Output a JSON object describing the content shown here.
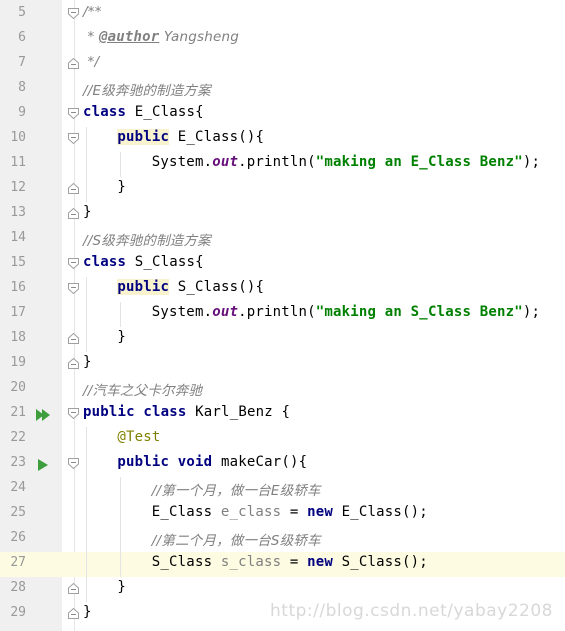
{
  "editor": {
    "language": "Java",
    "current_line": 27,
    "lines": [
      {
        "n": "5",
        "tokens": [
          {
            "t": "/**",
            "c": "comment"
          }
        ],
        "fold": "open"
      },
      {
        "n": "6",
        "tokens": [
          {
            "t": " * ",
            "c": "comment"
          },
          {
            "t": "@author",
            "c": "doctag"
          },
          {
            "t": " Yangsheng",
            "c": "comment"
          }
        ]
      },
      {
        "n": "7",
        "tokens": [
          {
            "t": " */",
            "c": "comment"
          }
        ],
        "fold": "close"
      },
      {
        "n": "8",
        "tokens": [
          {
            "t": "//E级奔驰的制造方案",
            "c": "comment"
          }
        ]
      },
      {
        "n": "9",
        "tokens": [
          {
            "t": "class",
            "c": "kw"
          },
          {
            "t": " E_Class{",
            "c": "plain"
          }
        ],
        "fold": "open"
      },
      {
        "n": "10",
        "indent": 1,
        "tokens": [
          {
            "t": "public",
            "c": "kw-hl"
          },
          {
            "t": " E_Class(){",
            "c": "plain"
          }
        ],
        "fold": "open"
      },
      {
        "n": "11",
        "indent": 2,
        "tokens": [
          {
            "t": "System.",
            "c": "plain"
          },
          {
            "t": "out",
            "c": "field"
          },
          {
            "t": ".println(",
            "c": "plain"
          },
          {
            "t": "\"making an E_Class Benz\"",
            "c": "str"
          },
          {
            "t": ");",
            "c": "plain"
          }
        ]
      },
      {
        "n": "12",
        "indent": 1,
        "tokens": [
          {
            "t": "}",
            "c": "plain"
          }
        ],
        "fold": "close"
      },
      {
        "n": "13",
        "tokens": [
          {
            "t": "}",
            "c": "plain"
          }
        ],
        "fold": "close"
      },
      {
        "n": "14",
        "tokens": [
          {
            "t": "//S级奔驰的制造方案",
            "c": "comment"
          }
        ]
      },
      {
        "n": "15",
        "tokens": [
          {
            "t": "class",
            "c": "kw"
          },
          {
            "t": " S_Class{",
            "c": "plain"
          }
        ],
        "fold": "open"
      },
      {
        "n": "16",
        "indent": 1,
        "tokens": [
          {
            "t": "public",
            "c": "kw-hl"
          },
          {
            "t": " S_Class(){",
            "c": "plain"
          }
        ],
        "fold": "open"
      },
      {
        "n": "17",
        "indent": 2,
        "tokens": [
          {
            "t": "System.",
            "c": "plain"
          },
          {
            "t": "out",
            "c": "field"
          },
          {
            "t": ".println(",
            "c": "plain"
          },
          {
            "t": "\"making an S_Class Benz\"",
            "c": "str"
          },
          {
            "t": ");",
            "c": "plain"
          }
        ]
      },
      {
        "n": "18",
        "indent": 1,
        "tokens": [
          {
            "t": "}",
            "c": "plain"
          }
        ],
        "fold": "close"
      },
      {
        "n": "19",
        "tokens": [
          {
            "t": "}",
            "c": "plain"
          }
        ],
        "fold": "close"
      },
      {
        "n": "20",
        "tokens": [
          {
            "t": "//汽车之父卡尔奔驰",
            "c": "comment"
          }
        ]
      },
      {
        "n": "21",
        "tokens": [
          {
            "t": "public class",
            "c": "kw"
          },
          {
            "t": " Karl_Benz {",
            "c": "plain"
          }
        ],
        "fold": "open",
        "run": "double"
      },
      {
        "n": "22",
        "indent": 1,
        "tokens": [
          {
            "t": "@Test",
            "c": "anno"
          }
        ]
      },
      {
        "n": "23",
        "indent": 1,
        "tokens": [
          {
            "t": "public void",
            "c": "kw"
          },
          {
            "t": " makeCar(){",
            "c": "plain"
          }
        ],
        "fold": "open",
        "run": "single"
      },
      {
        "n": "24",
        "indent": 2,
        "tokens": [
          {
            "t": "//第一个月，做一台E级轿车",
            "c": "comment"
          }
        ]
      },
      {
        "n": "25",
        "indent": 2,
        "tokens": [
          {
            "t": "E_Class ",
            "c": "plain"
          },
          {
            "t": "e_class",
            "c": "var"
          },
          {
            "t": " = ",
            "c": "plain"
          },
          {
            "t": "new",
            "c": "kw"
          },
          {
            "t": " E_Class();",
            "c": "plain"
          }
        ]
      },
      {
        "n": "26",
        "indent": 2,
        "tokens": [
          {
            "t": "//第二个月，做一台S级轿车",
            "c": "comment"
          }
        ]
      },
      {
        "n": "27",
        "indent": 2,
        "tokens": [
          {
            "t": "S_Class ",
            "c": "plain"
          },
          {
            "t": "s_class",
            "c": "var"
          },
          {
            "t": " = ",
            "c": "plain"
          },
          {
            "t": "new",
            "c": "kw"
          },
          {
            "t": " S_Class();",
            "c": "plain"
          }
        ]
      },
      {
        "n": "28",
        "indent": 1,
        "tokens": [
          {
            "t": "}",
            "c": "plain"
          }
        ],
        "fold": "close"
      },
      {
        "n": "29",
        "tokens": [
          {
            "t": "}",
            "c": "plain"
          }
        ],
        "fold": "close"
      }
    ]
  },
  "watermark": "http://blog.csdn.net/yabay2208",
  "colors": {
    "keyword": "#000080",
    "string": "#008000",
    "comment": "#808080",
    "field": "#660e7a",
    "annotation": "#808000",
    "run_icon": "#3e9e3e",
    "current_line": "#fdfbe1"
  },
  "icons": {
    "run_single": "run-test-icon",
    "run_double": "run-all-tests-icon",
    "fold_open": "fold-open-icon",
    "fold_close": "fold-close-icon"
  }
}
